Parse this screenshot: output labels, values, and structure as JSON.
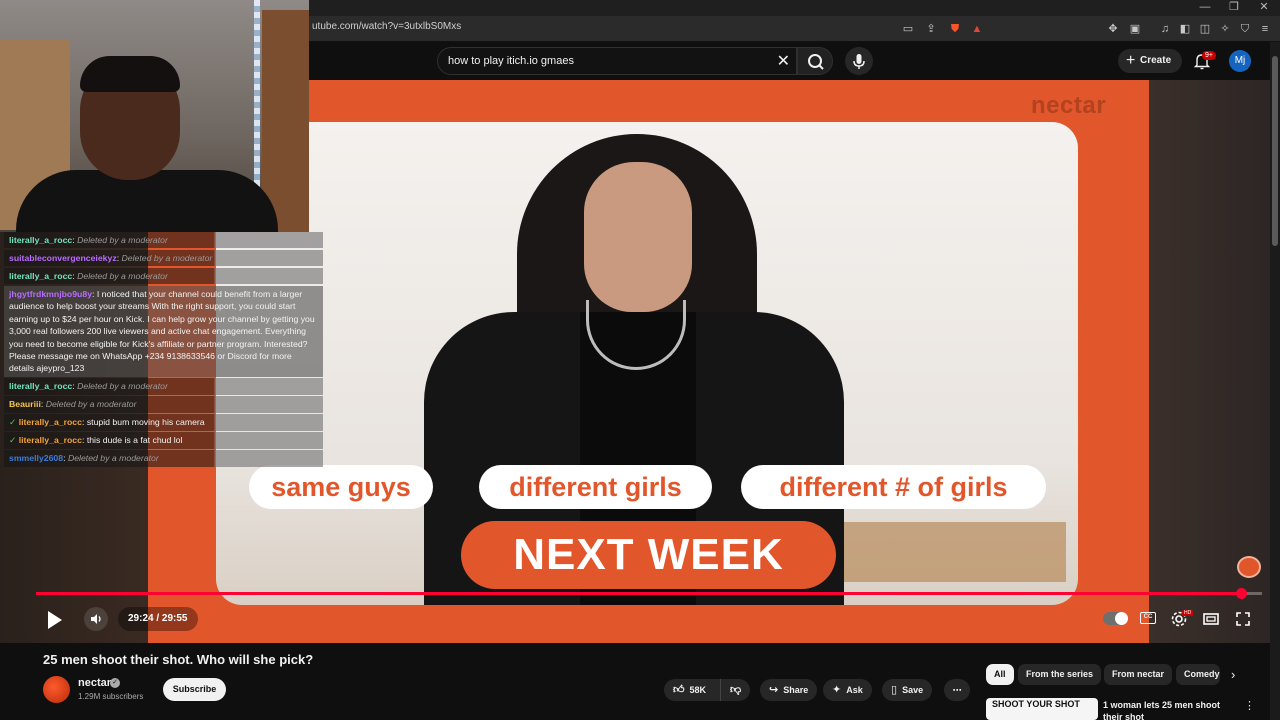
{
  "browser": {
    "url": "utube.com/watch?v=3utxlbS0Mxs",
    "window_controls": [
      "—",
      "❐",
      "✕"
    ]
  },
  "masthead": {
    "search_value": "how to play itich.io gmaes",
    "create_label": "Create",
    "notif_badge": "9+",
    "avatar_initials": "Mj"
  },
  "video": {
    "brand": "nectar",
    "pills": [
      "same guys",
      "different girls",
      "different # of girls"
    ],
    "next_week": "NEXT WEEK",
    "time": "29:24 / 29:55",
    "progress_fraction": 0.983
  },
  "chat": [
    {
      "user": "literally_a_rocc",
      "color": "#72e6c0",
      "text": "Deleted by a moderator",
      "deleted": true,
      "badge": false,
      "style": "grey-right"
    },
    {
      "user": "suitableconvergenceiekyz",
      "color": "#b86cff",
      "text": "Deleted by a moderator",
      "deleted": true,
      "badge": false,
      "style": "grey-right"
    },
    {
      "user": "literally_a_rocc",
      "color": "#72e6c0",
      "text": "Deleted by a moderator",
      "deleted": true,
      "badge": false,
      "style": "grey-right"
    },
    {
      "user": "jhgytfrdkmnjbo9u8y",
      "color": "#b86cff",
      "text": "I noticed that your channel could benefit from a larger audience to help boost your streams With the right support, you could start earning up to $24 per hour on Kick. I can help grow your channel by getting you 3,000 real followers 200 live viewers and active chat engagement. Everything you need to become eligible for Kick's affiliate or partner program. Interested? Please message me on WhatsApp +234 9138633546 or Discord for more details ajeypro_123",
      "deleted": false,
      "badge": false,
      "style": "block"
    },
    {
      "user": "literally_a_rocc",
      "color": "#72e6c0",
      "text": "Deleted by a moderator",
      "deleted": true,
      "badge": false,
      "style": "grey-right"
    },
    {
      "user": "Beauriii",
      "color": "#f2c94c",
      "text": "Deleted by a moderator",
      "deleted": true,
      "badge": false,
      "style": "grey-right"
    },
    {
      "user": "literally_a_rocc",
      "color": "#f2a33a",
      "text": "stupid bum moving his camera",
      "deleted": false,
      "badge": true,
      "style": "grey-right"
    },
    {
      "user": "literally_a_rocc",
      "color": "#f2a33a",
      "text": "this dude is a fat chud lol",
      "deleted": false,
      "badge": true,
      "style": "grey-right"
    },
    {
      "user": "smmelly2608",
      "color": "#3d7bd9",
      "text": "Deleted by a moderator",
      "deleted": true,
      "badge": false,
      "style": "grey-right"
    }
  ],
  "watch": {
    "title": "25 men shoot their shot. Who will she pick?",
    "channel": "nectar",
    "subscribers": "1.29M subscribers",
    "subscribe_label": "Subscribe",
    "likes": "58K",
    "share_label": "Share",
    "ask_label": "Ask",
    "save_label": "Save"
  },
  "chips": [
    "All",
    "From the series",
    "From nectar",
    "Comedy"
  ],
  "recommendation": {
    "thumb_text": "SHOOT YOUR SHOT",
    "title": "1 woman lets 25 men shoot their shot"
  }
}
